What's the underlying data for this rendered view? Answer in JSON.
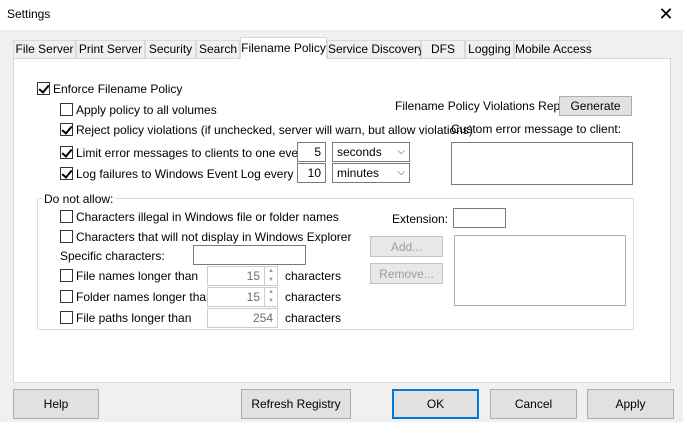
{
  "window": {
    "title": "Settings",
    "close_glyph": "✕"
  },
  "tabs": [
    "File Server",
    "Print Server",
    "Security",
    "Search",
    "Filename Policy",
    "Service Discovery",
    "DFS",
    "Logging",
    "Mobile Access"
  ],
  "active_tab": "Filename Policy",
  "policy": {
    "enforce": {
      "label": "Enforce Filename Policy",
      "checked": true
    },
    "apply_all": {
      "label": "Apply policy to all volumes",
      "checked": false
    },
    "reject": {
      "label": "Reject policy violations (if unchecked, server will warn, but allow violations)",
      "checked": true
    },
    "limit_errors": {
      "label": "Limit error messages to clients to one every",
      "checked": true,
      "value": "5",
      "unit": "seconds"
    },
    "log_failures": {
      "label": "Log failures to Windows Event Log every",
      "checked": true,
      "value": "10",
      "unit": "minutes"
    },
    "report_label": "Filename Policy Violations Report",
    "generate_button": "Generate",
    "custom_msg_label": "Custom error message to client:",
    "custom_msg_value": ""
  },
  "not_allow": {
    "title": "Do not allow:",
    "illegal_chars": {
      "label": "Characters illegal in Windows file or folder names",
      "checked": false
    },
    "no_display_chars": {
      "label": "Characters that will not display in Windows Explorer",
      "checked": false
    },
    "specific_chars_label": "Specific characters:",
    "specific_chars_value": "",
    "file_names": {
      "label": "File names longer than",
      "checked": false,
      "value": "15",
      "suffix": "characters"
    },
    "folder_names": {
      "label": "Folder names longer than",
      "checked": false,
      "value": "15",
      "suffix": "characters"
    },
    "file_paths": {
      "label": "File paths longer than",
      "checked": false,
      "value": "254",
      "suffix": "characters"
    },
    "extension_label": "Extension:",
    "extension_value": "",
    "add_button": "Add...",
    "remove_button": "Remove..."
  },
  "footer": {
    "help": "Help",
    "refresh": "Refresh Registry",
    "ok": "OK",
    "cancel": "Cancel",
    "apply": "Apply"
  }
}
